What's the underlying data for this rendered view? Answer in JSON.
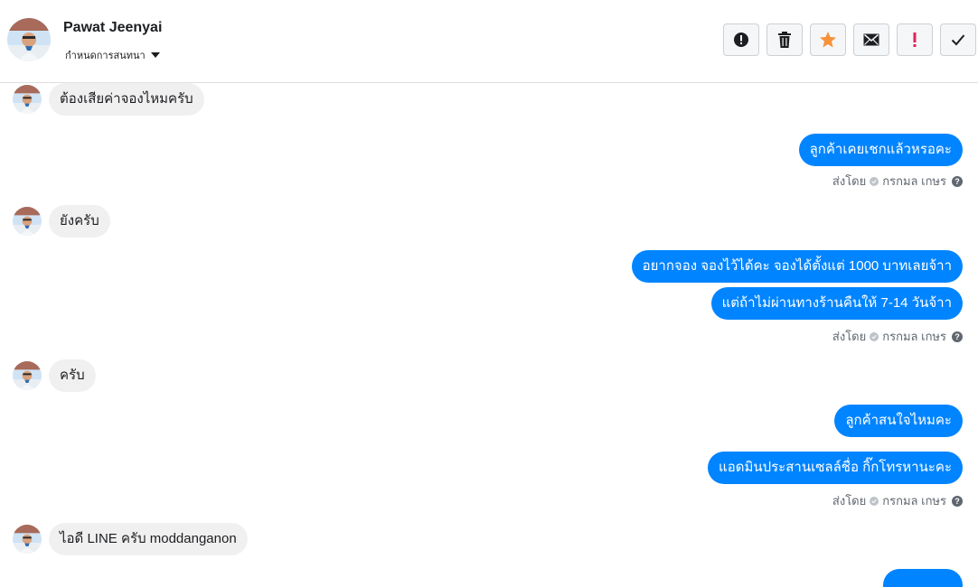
{
  "header": {
    "contact_name": "Pawat Jeenyai",
    "assign_label": "กำหนดการสนทนา",
    "toolbar": [
      {
        "name": "report-button",
        "icon": "exclamation-circle-icon"
      },
      {
        "name": "delete-button",
        "icon": "trash-icon"
      },
      {
        "name": "star-button",
        "icon": "star-icon",
        "color": "#f7923b"
      },
      {
        "name": "mark-unread-button",
        "icon": "envelope-icon"
      },
      {
        "name": "flag-button",
        "icon": "exclamation-icon",
        "color": "#e0245e"
      },
      {
        "name": "mark-done-button",
        "icon": "checkmark-icon"
      }
    ]
  },
  "messages": {
    "m1": "ต้องเสียค่าจองไหมครับ",
    "m2": "ลูกค้าเคยเชกแล้วหรอคะ",
    "m3": "ยังครับ",
    "m4": "อยากจอง จองไว้ได้คะ จองได้ตั้งแต่ 1000 บาทเลยจ้าา",
    "m5": "แต่ถ้าไม่ผ่านทางร้านคืนให้ 7-14 วันจ้าา",
    "m6": "ครับ",
    "m7": "ลูกค้าสนใจไหมคะ",
    "m8": "แอดมินประสานเซลล์ชื่อ กิ๊กโทรหานะคะ",
    "m9": "ไอดี LINE ครับ moddanganon"
  },
  "sent_by": {
    "label": "ส่งโดย",
    "agent": "กรกมล เกษร"
  },
  "colors": {
    "outgoing": "#0084ff",
    "incoming": "#f1f0f0"
  }
}
